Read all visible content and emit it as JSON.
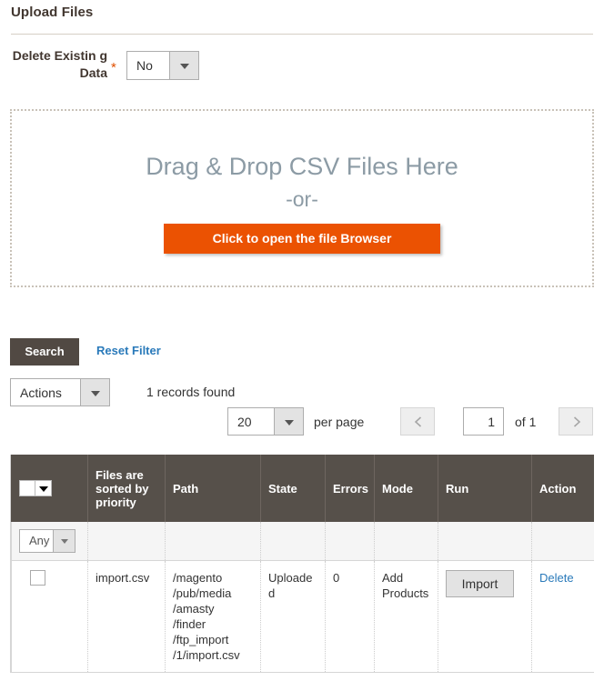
{
  "section": {
    "title": "Upload Files"
  },
  "form": {
    "delete_existing_data": {
      "label": "Delete Existin g Data",
      "required_mark": "*",
      "value": "No"
    }
  },
  "dropzone": {
    "title": "Drag & Drop CSV Files Here",
    "or": "-or-",
    "button_label": "Click to open the file Browser",
    "accent_color": "#eb5202"
  },
  "toolbar": {
    "search_label": "Search",
    "reset_filter_label": "Reset Filter",
    "actions_value": "Actions",
    "records_found": "1 records found"
  },
  "pager": {
    "per_page_value": "20",
    "per_page_label": "per page",
    "prev_icon": "chevron-left-icon",
    "next_icon": "chevron-right-icon",
    "current_page": "1",
    "of_label": "of 1"
  },
  "grid": {
    "columns": [
      {
        "key": "checkbox",
        "label": ""
      },
      {
        "key": "file",
        "label": "Files are sorted by priority"
      },
      {
        "key": "path",
        "label": "Path"
      },
      {
        "key": "state",
        "label": "State"
      },
      {
        "key": "errors",
        "label": "Errors"
      },
      {
        "key": "mode",
        "label": "Mode"
      },
      {
        "key": "run",
        "label": "Run"
      },
      {
        "key": "action",
        "label": "Action"
      }
    ],
    "filters": {
      "checkbox_filter_value": "Any"
    },
    "rows": [
      {
        "file": "import.csv",
        "path": "/magento\n/pub/media\n/amasty\n/finder\n/ftp_import\n/1/import.csv",
        "state": "Uploaded",
        "errors": "0",
        "mode": "Add Products",
        "run_label": "Import",
        "action_label": "Delete"
      }
    ]
  }
}
